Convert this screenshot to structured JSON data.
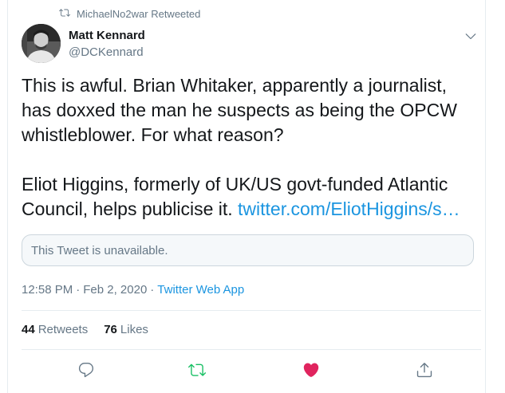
{
  "retweet_banner": {
    "text": "MichaelNo2war Retweeted",
    "icon": "retweet-icon"
  },
  "author": {
    "name": "Matt Kennard",
    "handle": "@DCKennard"
  },
  "tweet": {
    "text": "This is awful. Brian Whitaker, apparently a journalist, has doxxed the man he suspects as being the OPCW whistleblower. For what reason?\n\nEliot Higgins, formerly of UK/US govt-funded Atlantic Council, helps publicise it. ",
    "link": "twitter.com/EliotHiggins/s…"
  },
  "quoted_tweet": {
    "text": "This Tweet is unavailable."
  },
  "meta": {
    "time": "12:58 PM",
    "separator": "·",
    "date": "Feb 2, 2020",
    "separator2": "·",
    "app": "Twitter Web App"
  },
  "stats": {
    "retweets_count": "44",
    "retweets_label": "Retweets",
    "likes_count": "76",
    "likes_label": "Likes"
  },
  "colors": {
    "link": "#1b95e0",
    "retweet_green": "#17bf63",
    "like_red": "#e0245e",
    "muted": "#657786"
  }
}
